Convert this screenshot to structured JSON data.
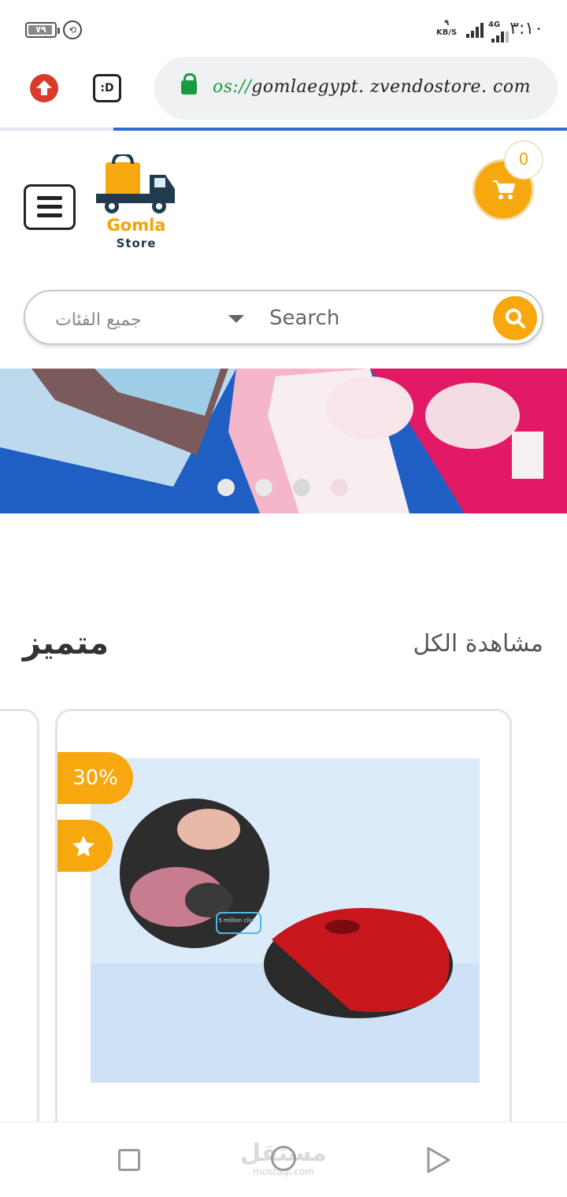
{
  "status_bar": {
    "battery": "٧٩",
    "net_speed_value": "٩",
    "net_speed_unit": "KB/S",
    "network_type": "4G",
    "time": "٣:١٠"
  },
  "browser": {
    "url_scheme": "os://",
    "url_host": "gomlaegypt. zvendostore. com",
    "tab_button_label": ":D",
    "load_progress": 0.8
  },
  "header": {
    "logo_name": "Gomla",
    "logo_sub": "Store",
    "cart_count": "0"
  },
  "search": {
    "category_label": "جميع الفئات",
    "placeholder": "Search"
  },
  "banner": {
    "slide_count": 4,
    "active_slide": 1
  },
  "section": {
    "title": "متميز",
    "view_all": "مشاهدة الكل"
  },
  "product": {
    "discount_badge": "30%",
    "image_caption": "5 million clicks"
  },
  "watermark": {
    "text": "مستقل",
    "sub": "mostaql.com"
  },
  "colors": {
    "accent": "#f8a80f",
    "url_secure": "#1a9a3f",
    "progress": "#2f6bd8",
    "upload": "#d93a2b"
  }
}
